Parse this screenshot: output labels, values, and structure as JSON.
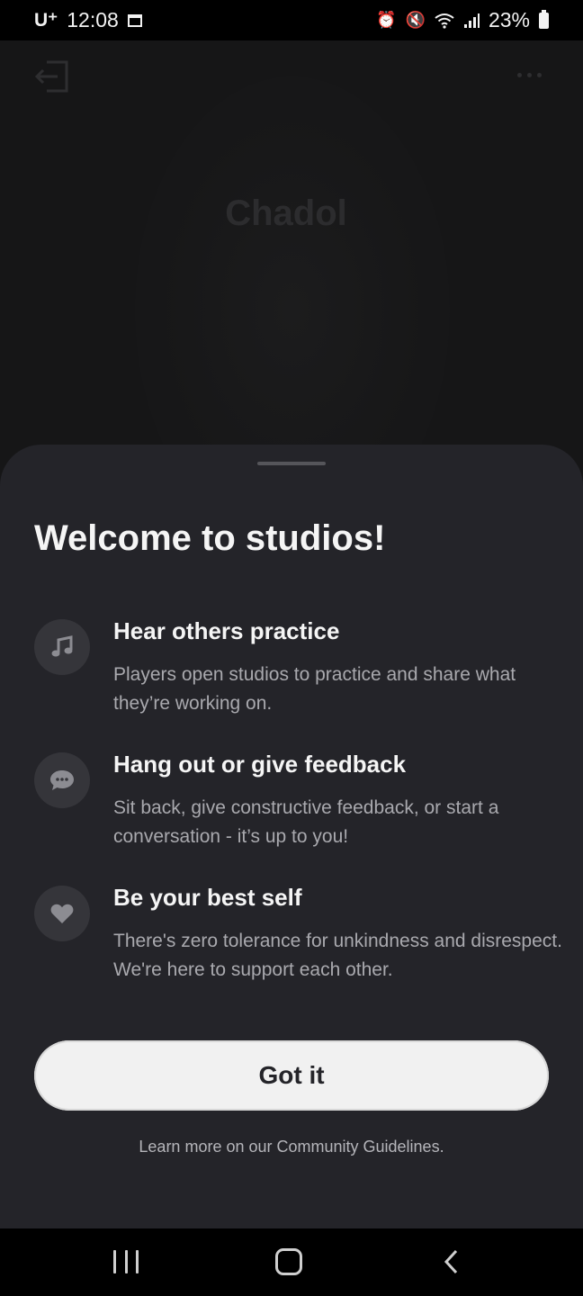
{
  "status_bar": {
    "carrier": "U⁺",
    "time": "12:08",
    "battery": "23%"
  },
  "background": {
    "title": "Chadol"
  },
  "sheet": {
    "title": "Welcome to studios!",
    "features": [
      {
        "icon": "music-note-icon",
        "title": "Hear others practice",
        "description": "Players open studios to practice and share what they’re working on."
      },
      {
        "icon": "chat-bubble-icon",
        "title": "Hang out or give feedback",
        "description": "Sit back, give constructive feedback, or start a conversation - it’s up to you!"
      },
      {
        "icon": "heart-icon",
        "title": "Be your best self",
        "description": "There's zero tolerance for unkindness and disrespect. We're here to support each other."
      }
    ],
    "primary_button": "Got it",
    "footer_link": "Learn more on our Community Guidelines."
  },
  "colors": {
    "sheet_background": "#242429",
    "icon_circle": "#35353a",
    "button_background": "#f1f1f1",
    "muted_text": "#a9a9ae"
  }
}
